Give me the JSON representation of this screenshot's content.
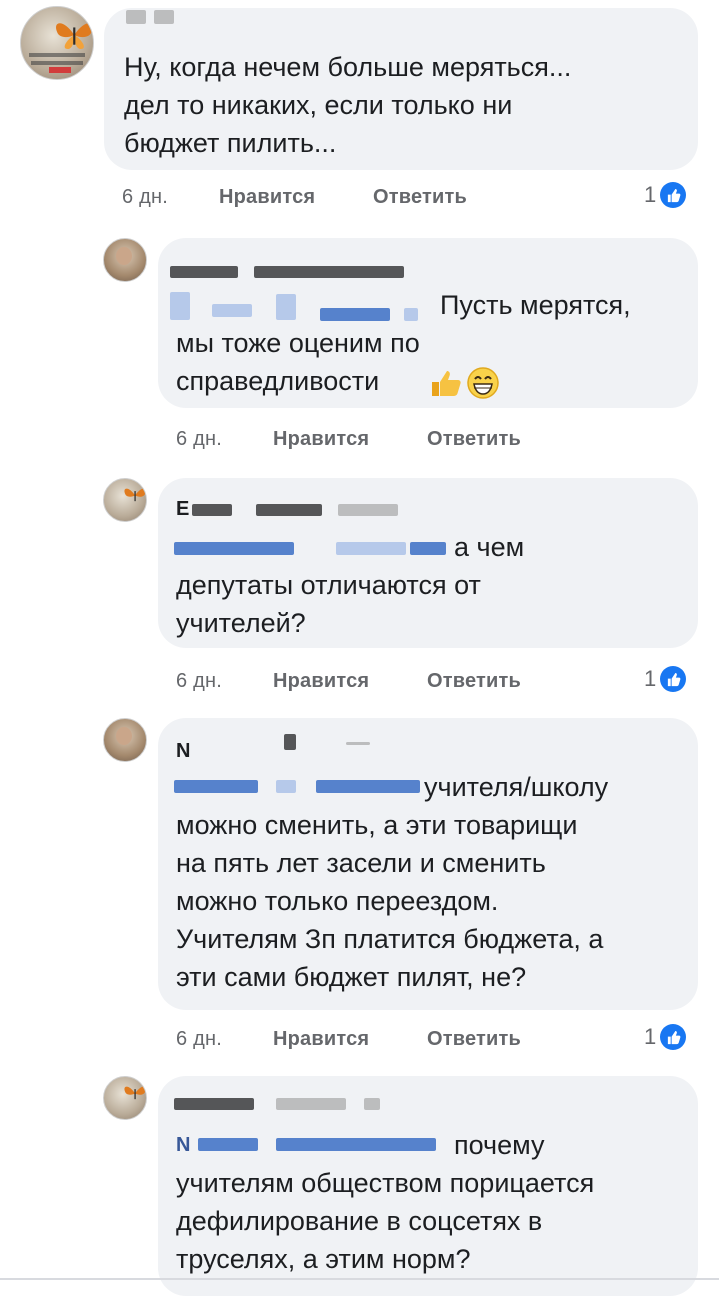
{
  "comments": [
    {
      "text": "Ну, когда нечем больше меряться...\nдел то никаких, если только ни\nбюджет пилить...",
      "age": "6 дн.",
      "like_label": "Нравится",
      "reply_label": "Ответить",
      "reaction_count": "1"
    },
    {
      "tag_suffix": "Пусть мерятся,",
      "text": "мы тоже оценим по\nсправедливости",
      "age": "6 дн.",
      "like_label": "Нравится",
      "reply_label": "Ответить"
    },
    {
      "name_fragment": "Е",
      "tag_suffix": "а чем",
      "text": "депутаты отличаются от\nучителей?",
      "age": "6 дн.",
      "like_label": "Нравится",
      "reply_label": "Ответить",
      "reaction_count": "1"
    },
    {
      "name_fragment": "N",
      "tag_suffix": "учителя/школу",
      "text": "можно сменить, а эти товарищи\nна пять лет засели и сменить\nможно только переездом.\nУчителям Зп платится бюджета, а\nэти сами бюджет пилят, не?",
      "age": "6 дн.",
      "like_label": "Нравится",
      "reply_label": "Ответить",
      "reaction_count": "1"
    },
    {
      "tag_prefix": "N",
      "tag_suffix": "почему",
      "text": "учителям обществом порицается\nдефилирование в соцсетях в\nтруселях, а этим норм?"
    }
  ],
  "colors": {
    "bubble": "#f0f2f5",
    "meta": "#65676b",
    "like_blue": "#1877f2",
    "text": "#1c1e21"
  }
}
